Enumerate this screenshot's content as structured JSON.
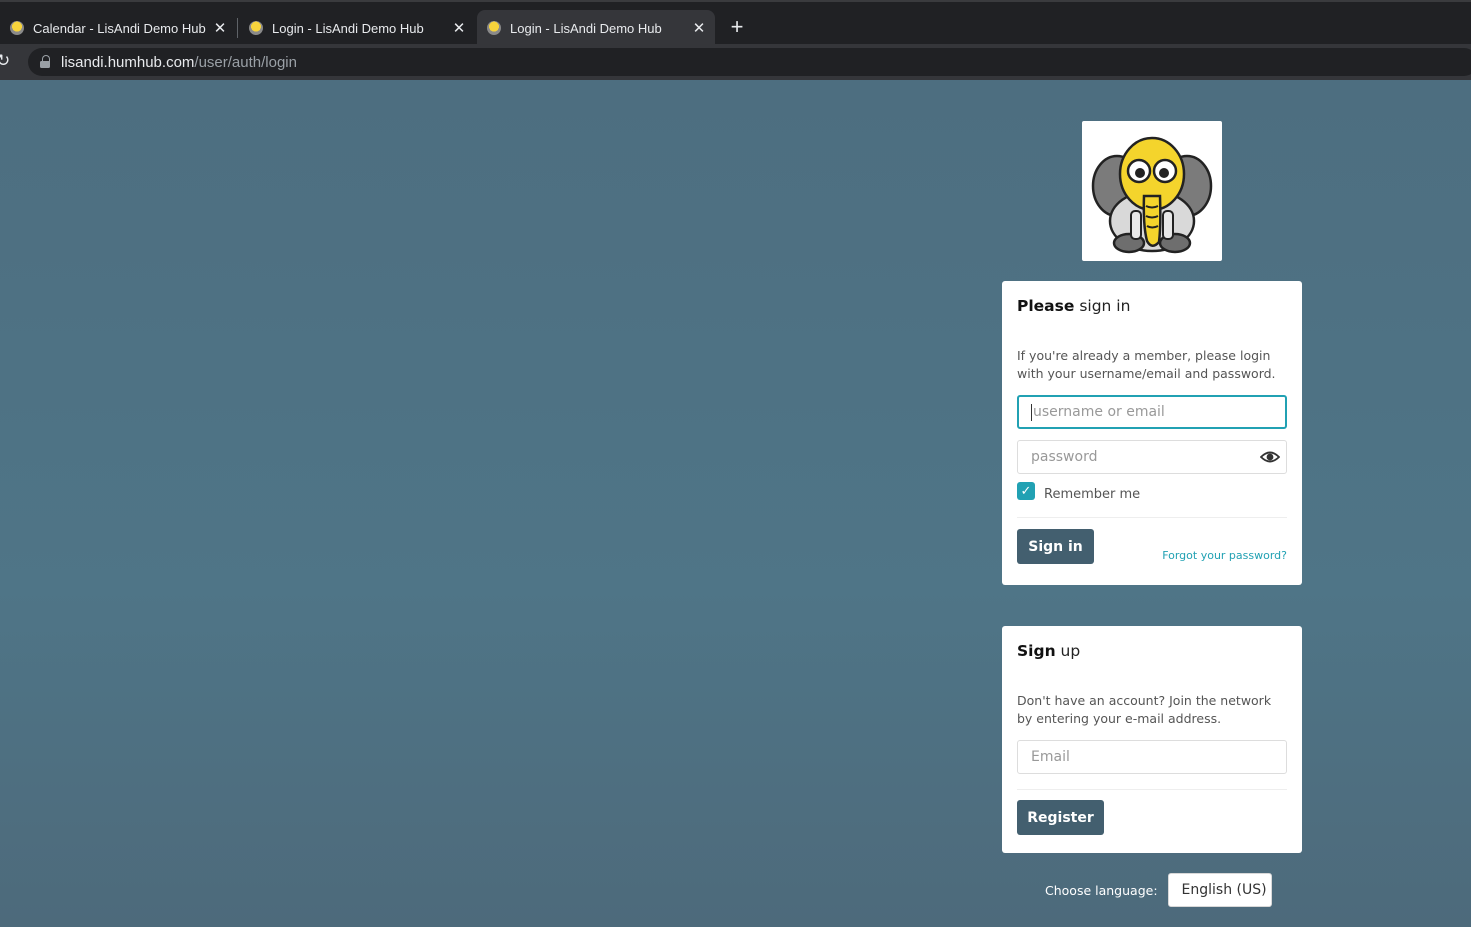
{
  "browser": {
    "tabs": [
      {
        "title": "Calendar - LisAndi Demo Hub",
        "close": "✕"
      },
      {
        "title": "Login - LisAndi Demo Hub",
        "close": "✕"
      },
      {
        "title": "Login - LisAndi Demo Hub",
        "close": "✕",
        "active": true
      }
    ],
    "new_tab": "+",
    "address": {
      "host": "lisandi.humhub.com",
      "path": "/user/auth/login"
    }
  },
  "login": {
    "heading_bold": "Please",
    "heading_rest": " sign in",
    "description": "If you're already a member, please login with your username/email and password.",
    "username_placeholder": "username or email",
    "password_placeholder": "password",
    "remember_label": "Remember me",
    "remember_checked": true,
    "submit_label": "Sign in",
    "forgot_label": "Forgot your password?"
  },
  "signup": {
    "heading_bold": "Sign",
    "heading_rest": " up",
    "description": "Don't have an account? Join the network by entering your e-mail address.",
    "email_placeholder": "Email",
    "submit_label": "Register"
  },
  "language": {
    "label": "Choose language:",
    "selected": "English (US)"
  },
  "colors": {
    "accent": "#21a1b3",
    "button": "#435f6f",
    "background": "#4f7587"
  },
  "icons": {
    "logo": "elephant-logo",
    "password_toggle": "eye-icon",
    "lock": "lock-icon",
    "reload": "reload-icon"
  }
}
